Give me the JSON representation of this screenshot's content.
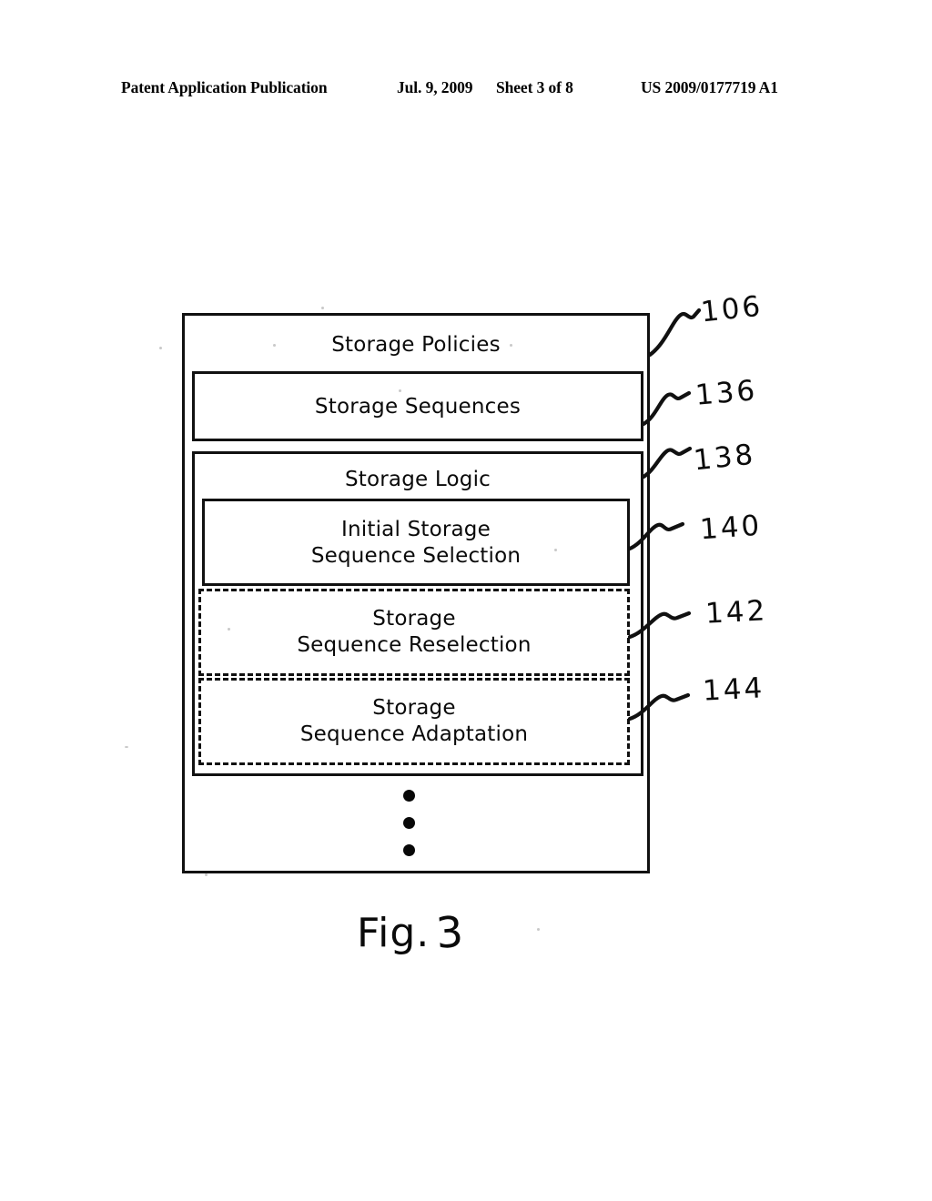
{
  "header": {
    "publication": "Patent Application Publication",
    "date": "Jul. 9, 2009",
    "sheet": "Sheet 3 of 8",
    "patent_number": "US 2009/0177719 A1"
  },
  "figure": {
    "caption_prefix": "Fig.",
    "caption_number": "3",
    "ellipsis_dots": 3
  },
  "diagram": {
    "boxes": [
      {
        "id": "storage-policies",
        "label": "Storage Policies",
        "ref": "106",
        "style": "solid",
        "level": 0
      },
      {
        "id": "storage-sequences",
        "label": "Storage Sequences",
        "ref": "136",
        "style": "solid",
        "level": 1
      },
      {
        "id": "storage-logic",
        "label": "Storage Logic",
        "ref": "138",
        "style": "solid",
        "level": 1
      },
      {
        "id": "initial-selection",
        "label": "Initial Storage\nSequence Selection",
        "ref": "140",
        "style": "solid",
        "level": 2
      },
      {
        "id": "sequence-reselection",
        "label": "Storage\nSequence Reselection",
        "ref": "142",
        "style": "dashed",
        "level": 2
      },
      {
        "id": "sequence-adaptation",
        "label": "Storage\nSequence Adaptation",
        "ref": "144",
        "style": "dashed",
        "level": 2
      }
    ]
  },
  "colors": {
    "ink": "#111111",
    "paper": "#ffffff"
  }
}
